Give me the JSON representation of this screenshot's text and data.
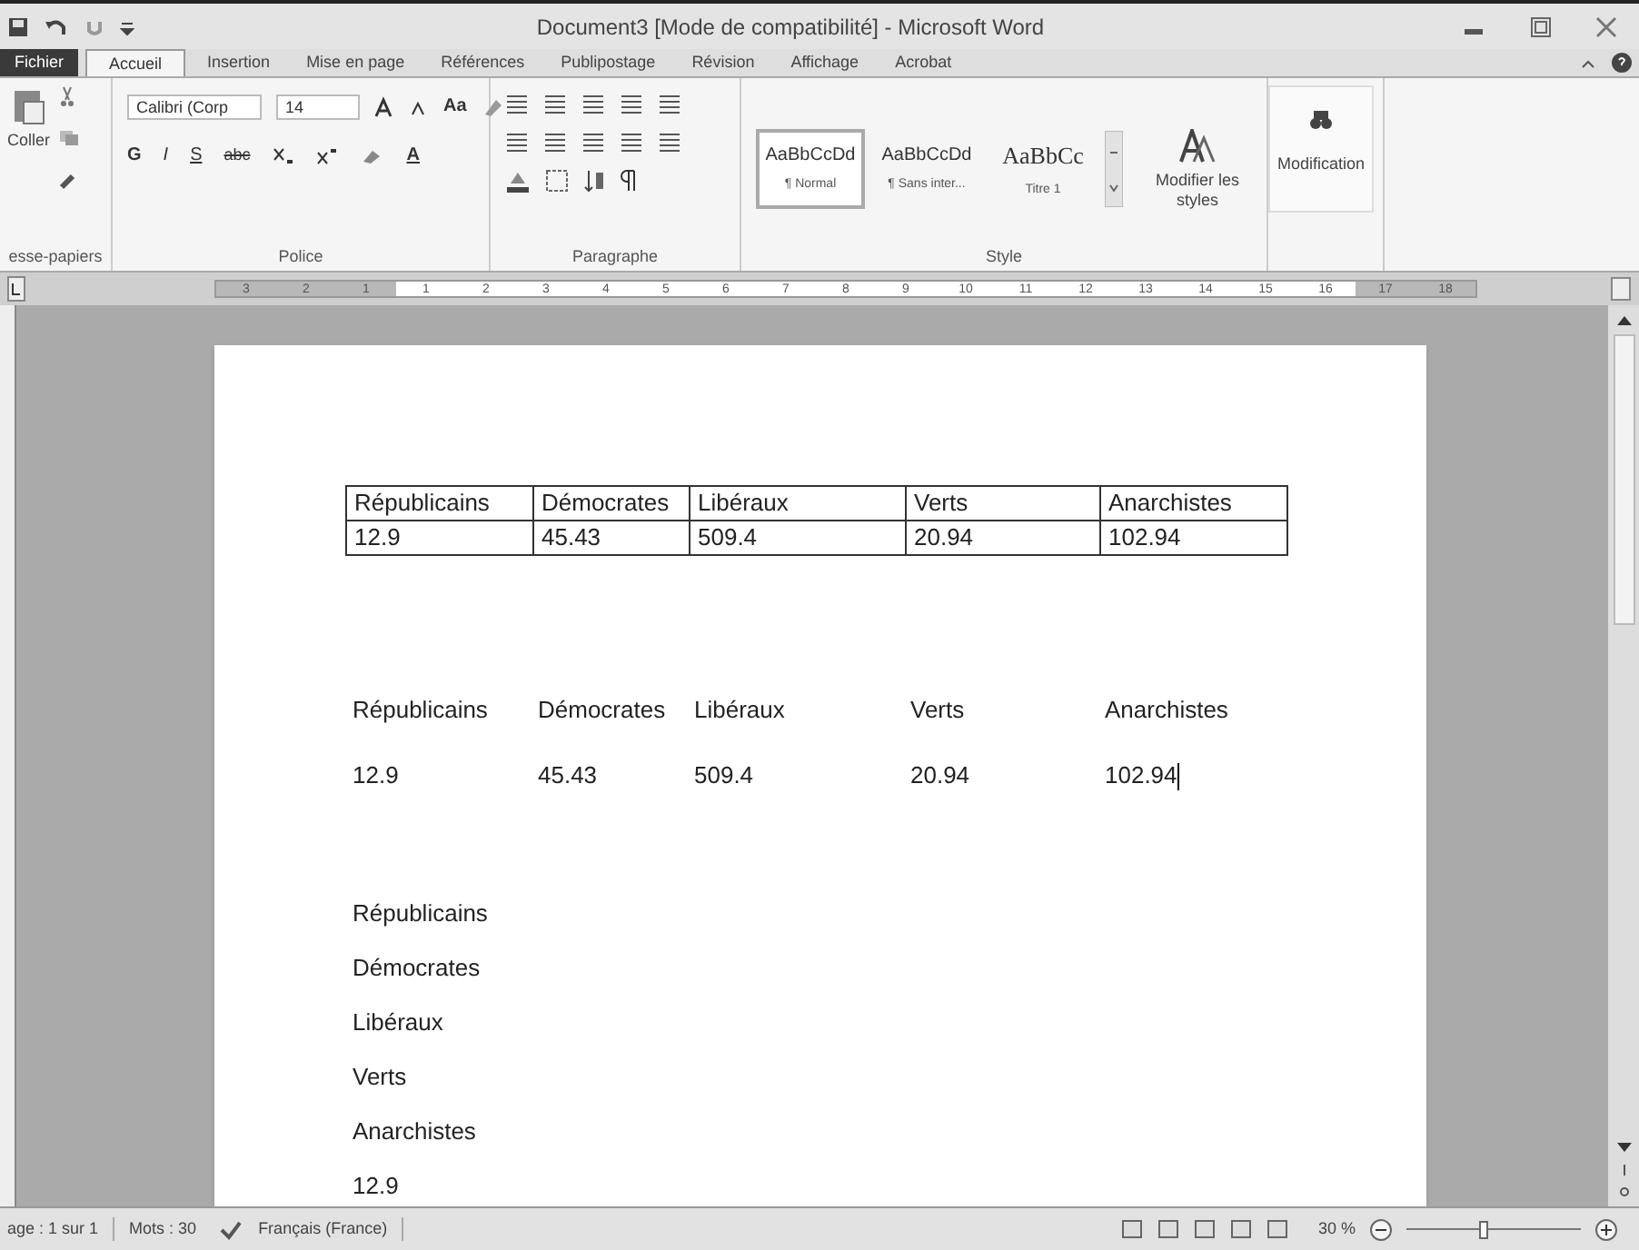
{
  "window": {
    "title": "Document3 [Mode de compatibilité] - Microsoft Word"
  },
  "ribbon_tabs": [
    {
      "label": "Fichier",
      "kind": "file",
      "selected": false
    },
    {
      "label": "Accueil",
      "kind": "tab",
      "selected": true
    },
    {
      "label": "Insertion",
      "kind": "tab",
      "selected": false
    },
    {
      "label": "Mise en page",
      "kind": "tab",
      "selected": false
    },
    {
      "label": "Références",
      "kind": "tab",
      "selected": false
    },
    {
      "label": "Publipostage",
      "kind": "tab",
      "selected": false
    },
    {
      "label": "Révision",
      "kind": "tab",
      "selected": false
    },
    {
      "label": "Affichage",
      "kind": "tab",
      "selected": false
    },
    {
      "label": "Acrobat",
      "kind": "tab",
      "selected": false
    }
  ],
  "clipboard": {
    "paste_label": "Coller",
    "group_label": "esse-papiers"
  },
  "font": {
    "font_name": "Calibri (Corp",
    "font_size": "14",
    "change_case": "Aa",
    "bold": "G",
    "italic": "I",
    "underline": "S",
    "strikethrough": "abc",
    "font_color": "A",
    "group_label": "Police"
  },
  "paragraph": {
    "group_label": "Paragraphe"
  },
  "styles": {
    "items": [
      {
        "preview": "AaBbCcDd",
        "name": "¶ Normal",
        "selected": true
      },
      {
        "preview": "AaBbCcDd",
        "name": "¶ Sans inter...",
        "selected": false
      },
      {
        "preview": "AaBbCc",
        "name": "Titre 1",
        "selected": false
      }
    ],
    "change_styles": "Modifier les styles",
    "group_label": "Style"
  },
  "editing": {
    "label": "Modification"
  },
  "ruler": [
    {
      "label": "3",
      "margin": true
    },
    {
      "label": "2",
      "margin": true
    },
    {
      "label": "1",
      "margin": true
    },
    {
      "label": "1",
      "margin": false
    },
    {
      "label": "2",
      "margin": false
    },
    {
      "label": "3",
      "margin": false
    },
    {
      "label": "4",
      "margin": false
    },
    {
      "label": "5",
      "margin": false
    },
    {
      "label": "6",
      "margin": false
    },
    {
      "label": "7",
      "margin": false
    },
    {
      "label": "8",
      "margin": false
    },
    {
      "label": "9",
      "margin": false
    },
    {
      "label": "10",
      "margin": false
    },
    {
      "label": "11",
      "margin": false
    },
    {
      "label": "12",
      "margin": false
    },
    {
      "label": "13",
      "margin": false
    },
    {
      "label": "14",
      "margin": false
    },
    {
      "label": "15",
      "margin": false
    },
    {
      "label": "16",
      "margin": false
    },
    {
      "label": "17",
      "margin": true
    },
    {
      "label": "18",
      "margin": true
    }
  ],
  "document": [
    {
      "kind": "table",
      "rows": [
        [
          "Républicains",
          "Démocrates",
          "Libéraux",
          "Verts",
          "Anarchistes"
        ],
        [
          "12.9",
          "45.43",
          "509.4",
          "20.94",
          "102.94"
        ]
      ]
    },
    {
      "kind": "tabbed",
      "rows": [
        [
          "Républicains",
          "Démocrates",
          "Libéraux",
          "Verts",
          "Anarchistes"
        ],
        [
          "12.9",
          "45.43",
          "509.4",
          "20.94",
          "102.94"
        ]
      ]
    },
    {
      "kind": "lines",
      "lines": [
        "Républicains",
        "Démocrates",
        "Libéraux",
        "Verts",
        "Anarchistes",
        "12.9"
      ]
    }
  ],
  "status_bar": {
    "page": "age : 1 sur 1",
    "words": "Mots : 30",
    "language": "Français (France)",
    "zoom": "30 %",
    "zoom_slider": {
      "level": 0.45
    }
  }
}
